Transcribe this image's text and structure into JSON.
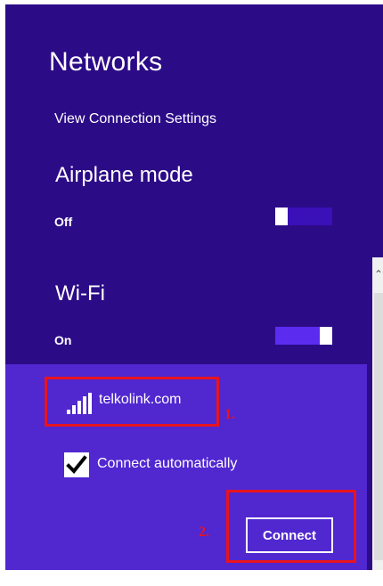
{
  "header": {
    "title": "Networks",
    "connection_settings_link": "View Connection Settings"
  },
  "airplane_mode": {
    "label": "Airplane mode",
    "state": "Off"
  },
  "wifi": {
    "label": "Wi-Fi",
    "state": "On"
  },
  "network": {
    "name": "telkolink.com",
    "signal_icon": "wifi-signal-bars-icon",
    "auto_connect_label": "Connect automatically",
    "auto_connect_checked": true,
    "connect_label": "Connect"
  },
  "annotations": {
    "step1": "1.",
    "step2": "2."
  },
  "colors": {
    "panel_bg": "#2c0b87",
    "selected_bg": "#5127d0",
    "highlight": "#e8141f",
    "toggle_off_track": "#3a10b8",
    "toggle_on_track": "#5b2cf0"
  }
}
